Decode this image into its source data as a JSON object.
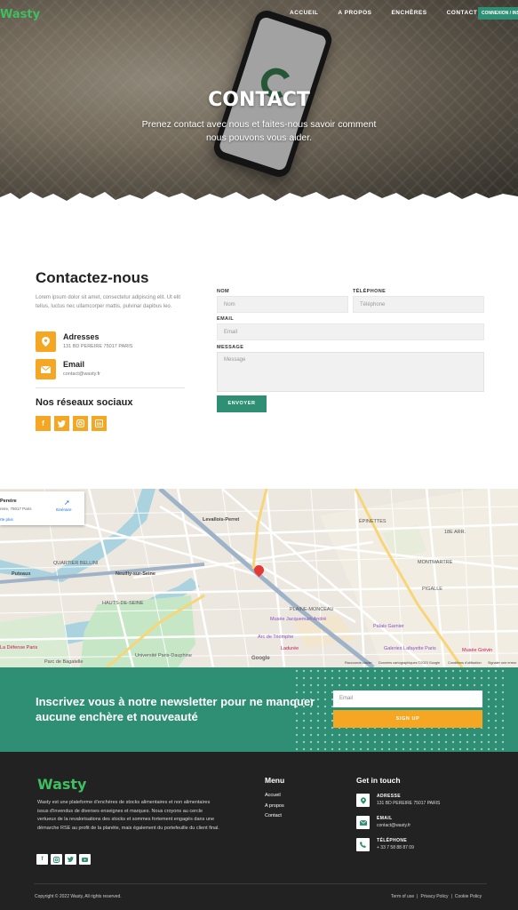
{
  "nav": {
    "brand": "Wasty",
    "links": [
      "ACCUEIL",
      "A PROPOS",
      "ENCHÈRES",
      "CONTACT"
    ],
    "login_label": "CONNEXION / INSCRIPTION"
  },
  "hero": {
    "title": "CONTACT",
    "subtitle": "Prenez contact avec nous et faites-nous savoir comment nous pouvons vous aider."
  },
  "contact": {
    "title": "Contactez-nous",
    "lorem": "Lorem ipsum dolor sit amet, consectetur adipiscing elit. Ut elit tellus, luctus nec ullamcorper mattis, pulvinar dapibus leo.",
    "address_label": "Adresses",
    "address_value": "131 BD PEREIRE 75017 PARIS",
    "email_label": "Email",
    "email_value": "contact@wasty.fr",
    "social_title": "Nos réseaux sociaux",
    "social_icons": [
      "facebook-icon",
      "twitter-icon",
      "instagram-icon",
      "linkedin-icon"
    ]
  },
  "form": {
    "name_label": "NOM",
    "name_placeholder": "Nom",
    "phone_label": "TÉLÉPHONE",
    "phone_placeholder": "Téléphone",
    "email_label": "EMAIL",
    "email_placeholder": "Email",
    "message_label": "MESSAGE",
    "message_placeholder": "Message",
    "submit": "ENVOYER"
  },
  "map": {
    "card_title": "Pereire",
    "card_address": "reire, 75017 Paris",
    "card_directions": "Itinéraire",
    "card_link": "rte plus",
    "labels": {
      "levallois": "Levallois-Perret",
      "epinettes": "ÉPINETTES",
      "arr17": "17E ARRONDISSEMENT",
      "arr18": "18E ARR.",
      "montmartre": "MONTMARTRE",
      "pigalle": "PIGALLE",
      "neuilly": "Neuilly-sur-Seine",
      "puteaux": "Puteaux",
      "hauts_seine": "HAUTS-DE-SEINE",
      "quartier": "QUARTIER BELLINI",
      "plaine_monceau": "PLAINE-MONCEAU",
      "jacquemart": "Musée Jacquemart-André",
      "arc": "Arc de Triomphe",
      "laduree": "Ladurée",
      "galeries": "Galeries Lafayette Paris",
      "musee_grevin": "Musée Grévin",
      "palais": "Palais Garnier",
      "defense": "La Défense Paris",
      "parc": "Parc de Bagatelle",
      "universite": "Université Paris-Dauphine",
      "chaussee": "CHAUSSÉE-D'ANTIN"
    },
    "google": "Google",
    "footer_items": [
      "Raccourcis clavier",
      "Données cartographiques ©2023 Google",
      "Conditions d'utilisation",
      "Signaler une erreur"
    ]
  },
  "newsletter": {
    "title": "Inscrivez vous à notre newsletter pour ne manquer aucune enchère et nouveauté",
    "email_placeholder": "Email",
    "button": "SIGN UP"
  },
  "footer": {
    "brand": "Wasty",
    "description": "Wasty est une plateforme d'enchères de stocks alimentaires et non alimentaires issus d'invendus de diverses enseignes et marques. Nous croyons au cercle vertueux de la revalorisations des stocks et sommes fortement engagés dans une démarche RSE au profit de la planète, mais également du portefeuille du client final.",
    "menu_title": "Menu",
    "menu_items": [
      "Accueil",
      "A propos",
      "Contact"
    ],
    "contact_title": "Get in touch",
    "address_label": "ADRESSE",
    "address_value": "131 BD PEREIRE 75017 PARIS",
    "email_label": "EMAIL",
    "email_value": "contact@wasty.fr",
    "phone_label": "TÉLÉPHONE",
    "phone_value": "+ 33 7 58 88 87 09",
    "copyright": "Copyright © 2022 Wasty, All rights reserved.",
    "legal_links": [
      "Term of use",
      "Privacy Policy",
      "Cookie Policy"
    ]
  },
  "colors": {
    "green": "#2f8f74",
    "orange": "#f5a623",
    "brand_green": "#3fbf5f",
    "footer_bg": "#222222"
  }
}
